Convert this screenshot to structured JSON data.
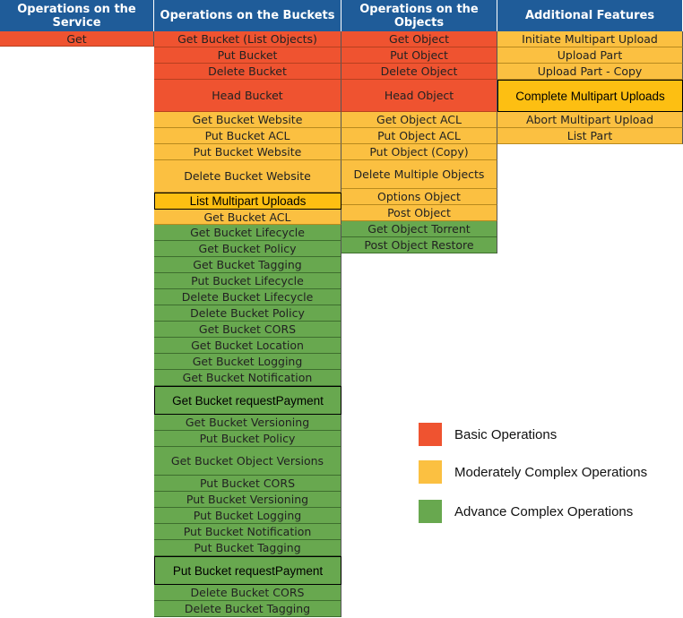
{
  "headers": [
    "Operations on the Service",
    "Operations on the Buckets",
    "Operations on the Objects",
    "Additional Features"
  ],
  "colors": {
    "basic": "#ef5330",
    "moderate": "#fbc041",
    "advance": "#68a84f",
    "header": "#1f5c99"
  },
  "service": [
    {
      "label": "Get",
      "level": "basic"
    }
  ],
  "buckets": [
    {
      "label": "Get Bucket (List Objects)",
      "level": "basic"
    },
    {
      "label": "Put Bucket",
      "level": "basic"
    },
    {
      "label": "Delete Bucket",
      "level": "basic"
    },
    {
      "label": "Head Bucket",
      "level": "basic"
    },
    {
      "label": "Get Bucket Website",
      "level": "moderate"
    },
    {
      "label": "Put Bucket ACL",
      "level": "moderate"
    },
    {
      "label": "Put Bucket Website",
      "level": "moderate"
    },
    {
      "label": "Delete Bucket Website",
      "level": "moderate"
    },
    {
      "label": "List Multipart Uploads",
      "level": "moderate"
    },
    {
      "label": "Get Bucket ACL",
      "level": "moderate"
    },
    {
      "label": "Get Bucket Lifecycle",
      "level": "advance"
    },
    {
      "label": "Get Bucket Policy",
      "level": "advance"
    },
    {
      "label": "Get Bucket Tagging",
      "level": "advance"
    },
    {
      "label": "Put Bucket Lifecycle",
      "level": "advance"
    },
    {
      "label": "Delete Bucket Lifecycle",
      "level": "advance"
    },
    {
      "label": "Delete Bucket Policy",
      "level": "advance"
    },
    {
      "label": "Get Bucket CORS",
      "level": "advance"
    },
    {
      "label": "Get Bucket Location",
      "level": "advance"
    },
    {
      "label": "Get Bucket Logging",
      "level": "advance"
    },
    {
      "label": "Get Bucket Notification",
      "level": "advance"
    },
    {
      "label": "Get Bucket requestPayment",
      "level": "advance"
    },
    {
      "label": "Get Bucket Versioning",
      "level": "advance"
    },
    {
      "label": "Put Bucket Policy",
      "level": "advance"
    },
    {
      "label": "Get Bucket Object Versions",
      "level": "advance"
    },
    {
      "label": "Put Bucket CORS",
      "level": "advance"
    },
    {
      "label": "Put Bucket Versioning",
      "level": "advance"
    },
    {
      "label": "Put Bucket Logging",
      "level": "advance"
    },
    {
      "label": "Put Bucket Notification",
      "level": "advance"
    },
    {
      "label": "Put Bucket Tagging",
      "level": "advance"
    },
    {
      "label": "Put Bucket requestPayment",
      "level": "advance"
    },
    {
      "label": "Delete Bucket CORS",
      "level": "advance"
    },
    {
      "label": "Delete Bucket Tagging",
      "level": "advance"
    }
  ],
  "objects": [
    {
      "label": "Get Object",
      "level": "basic"
    },
    {
      "label": "Put Object",
      "level": "basic"
    },
    {
      "label": "Delete Object",
      "level": "basic"
    },
    {
      "label": "Head Object",
      "level": "basic"
    },
    {
      "label": "Get Object ACL",
      "level": "moderate"
    },
    {
      "label": "Put Object ACL",
      "level": "moderate"
    },
    {
      "label": "Put Object (Copy)",
      "level": "moderate"
    },
    {
      "label": "Delete Multiple Objects",
      "level": "moderate"
    },
    {
      "label": "Options Object",
      "level": "moderate"
    },
    {
      "label": "Post Object",
      "level": "moderate"
    },
    {
      "label": "Get Object Torrent",
      "level": "advance"
    },
    {
      "label": "Post Object Restore",
      "level": "advance"
    }
  ],
  "additional": [
    {
      "label": "Initiate Multipart Upload",
      "level": "moderate"
    },
    {
      "label": "Upload Part",
      "level": "moderate"
    },
    {
      "label": "Upload Part - Copy",
      "level": "moderate"
    },
    {
      "label": "Complete Multipart Uploads",
      "level": "moderate"
    },
    {
      "label": "Abort Multipart Upload",
      "level": "moderate"
    },
    {
      "label": "List Part",
      "level": "moderate"
    }
  ],
  "legend": [
    {
      "label": "Basic Operations",
      "level": "basic"
    },
    {
      "label": "Moderately Complex Operations",
      "level": "moderate"
    },
    {
      "label": "Advance Complex Operations",
      "level": "advance"
    }
  ]
}
